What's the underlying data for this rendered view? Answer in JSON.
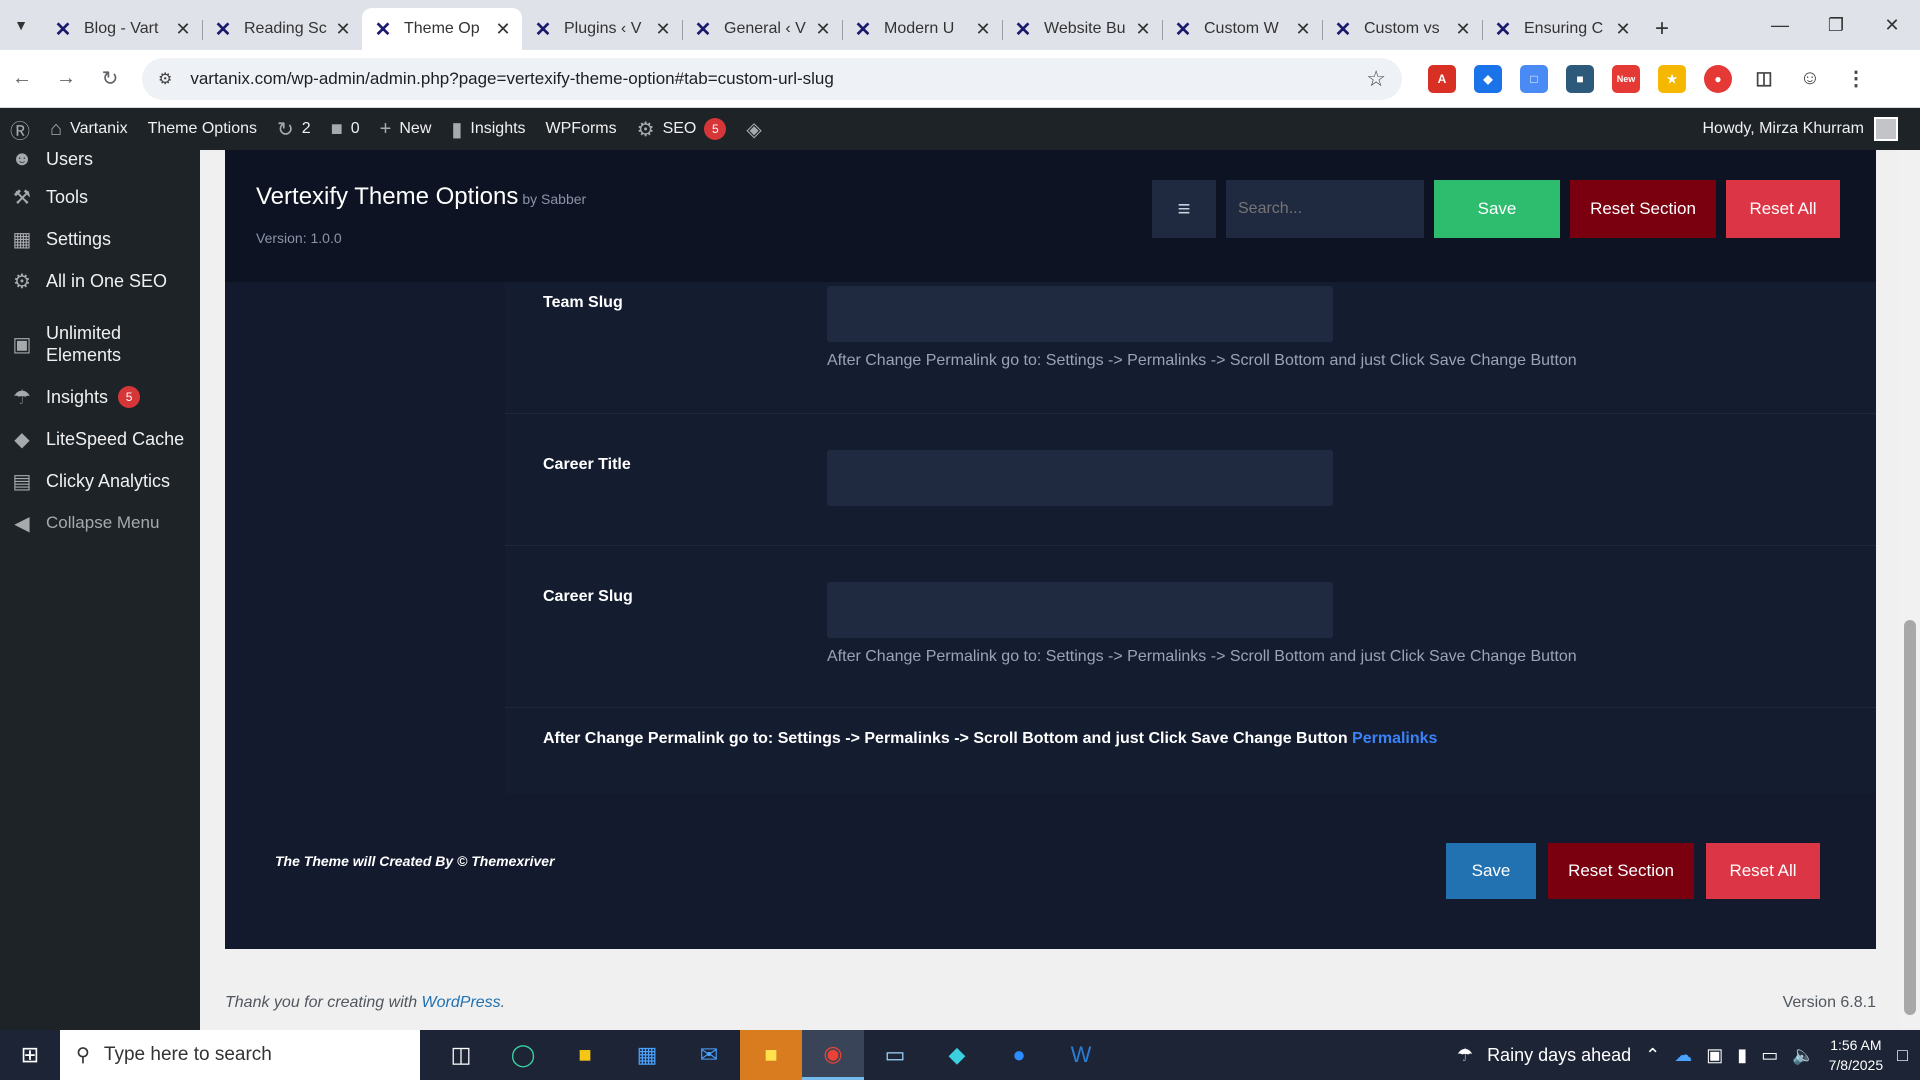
{
  "browser": {
    "tabs": [
      {
        "title": "Blog - Vart",
        "active": false
      },
      {
        "title": "Reading Sc",
        "active": false
      },
      {
        "title": "Theme Op",
        "active": true
      },
      {
        "title": "Plugins ‹ V",
        "active": false
      },
      {
        "title": "General ‹ V",
        "active": false
      },
      {
        "title": "Modern U",
        "active": false
      },
      {
        "title": "Website Bu",
        "active": false
      },
      {
        "title": "Custom W",
        "active": false
      },
      {
        "title": "Custom vs",
        "active": false
      },
      {
        "title": "Ensuring C",
        "active": false
      }
    ],
    "url": "vartanix.com/wp-admin/admin.php?page=vertexify-theme-option#tab=custom-url-slug",
    "extension_badge": "New"
  },
  "adminbar": {
    "site_name": "Vartanix",
    "theme_options": "Theme Options",
    "updates_count": "2",
    "comments_count": "0",
    "new_label": "New",
    "insights_label": "Insights",
    "wpforms_label": "WPForms",
    "seo_label": "SEO",
    "seo_badge": "5",
    "howdy": "Howdy, Mirza Khurram"
  },
  "sidebar": {
    "items": [
      {
        "label": "Users",
        "icon": "users-icon"
      },
      {
        "label": "Tools",
        "icon": "tools-icon"
      },
      {
        "label": "Settings",
        "icon": "settings-icon"
      },
      {
        "label": "All in One SEO",
        "icon": "seo-icon"
      },
      {
        "label": "Unlimited Elements",
        "icon": "elements-icon"
      },
      {
        "label": "Insights",
        "icon": "insights-icon",
        "badge": "5"
      },
      {
        "label": "LiteSpeed Cache",
        "icon": "litespeed-icon"
      },
      {
        "label": "Clicky Analytics",
        "icon": "clicky-icon"
      },
      {
        "label": "Collapse Menu",
        "icon": "collapse-icon"
      }
    ]
  },
  "options": {
    "title": "Vertexify Theme Options",
    "by": "by Sabber",
    "version": "Version: 1.0.0",
    "search_placeholder": "Search...",
    "save_label": "Save",
    "reset_section_label": "Reset Section",
    "reset_all_label": "Reset All",
    "fields": [
      {
        "label": "Team Slug",
        "value": "",
        "hint": "After Change Permalink go to: Settings -> Permalinks -> Scroll Bottom and just Click Save Change Button"
      },
      {
        "label": "Career Title",
        "value": ""
      },
      {
        "label": "Career Slug",
        "value": "",
        "hint": "After Change Permalink go to: Settings -> Permalinks -> Scroll Bottom and just Click Save Change Button"
      }
    ],
    "note": "After Change Permalink go to: Settings -> Permalinks -> Scroll Bottom and just Click Save Change Button",
    "note_link": "Permalinks",
    "credit": "The Theme will Created By © Themexriver"
  },
  "wp_footer": {
    "thanks": "Thank you for creating with",
    "wp_link": "WordPress",
    "version": "Version 6.8.1"
  },
  "taskbar": {
    "search_placeholder": "Type here to search",
    "weather": "Rainy days ahead",
    "time": "1:56 AM",
    "date": "7/8/2025"
  }
}
